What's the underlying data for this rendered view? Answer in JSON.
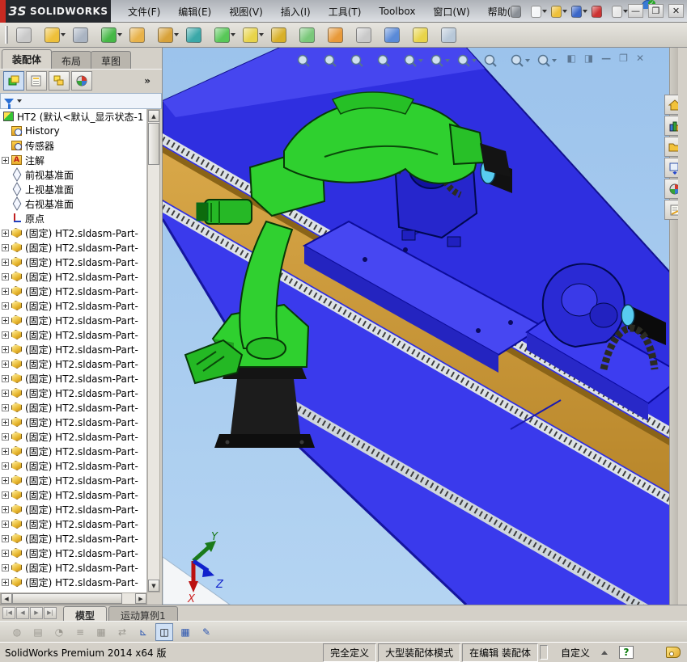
{
  "titlebar": {
    "logo_prefix": "ЗS",
    "logo_text": "SOLIDWORKS",
    "menus": [
      "文件(F)",
      "编辑(E)",
      "视图(V)",
      "插入(I)",
      "工具(T)",
      "Toolbox",
      "窗口(W)",
      "帮助(H)"
    ],
    "quick_icons": [
      {
        "name": "search-icon",
        "glyph": "🔎",
        "color": "#8a8f96",
        "caret": false
      },
      {
        "name": "new-document-icon",
        "glyph": "▯",
        "color": "#f4f6f8",
        "caret": true
      },
      {
        "name": "open-icon",
        "glyph": "▰",
        "color": "#eec03a",
        "caret": true
      },
      {
        "name": "save-icon",
        "glyph": "▦",
        "color": "#3a66c8",
        "caret": true
      },
      {
        "name": "performance-icon",
        "glyph": "▮",
        "color": "#cc3333",
        "caret": false
      },
      {
        "name": "help-icon",
        "glyph": "?",
        "color": "#e8e8e8",
        "caret": true
      }
    ],
    "window_buttons": [
      {
        "name": "minimize-button",
        "glyph": "—"
      },
      {
        "name": "restore-button",
        "glyph": "❐"
      },
      {
        "name": "close-button",
        "glyph": "✕"
      }
    ]
  },
  "main_toolbar": [
    {
      "name": "insert-component-button",
      "color": "#c9c9c9",
      "caret": false
    },
    {
      "name": "open-part-button",
      "color": "#eec03a",
      "caret": true
    },
    {
      "name": "mate-button",
      "color": "#aab4c2",
      "caret": false
    },
    {
      "name": "component-pattern-button",
      "color": "#46b846",
      "caret": true
    },
    {
      "name": "smart-fasteners-button",
      "color": "#e8b24a",
      "caret": false
    },
    {
      "name": "move-component-button",
      "color": "#d8a23a",
      "caret": true
    },
    {
      "name": "show-hidden-components-button",
      "color": "#3aa8a8",
      "caret": false
    },
    {
      "name": "assembly-features-button",
      "color": "#58c858",
      "caret": true
    },
    {
      "name": "reference-geometry-button",
      "color": "#e8d44a",
      "caret": true
    },
    {
      "name": "new-motion-study-button",
      "color": "#d8b028",
      "caret": false
    },
    {
      "name": "bill-of-materials-button",
      "color": "#7ac87a",
      "caret": false
    },
    {
      "name": "exploded-view-button",
      "color": "#e89a3a",
      "caret": false
    },
    {
      "name": "explode-line-sketch-button",
      "color": "#c9c9c9",
      "caret": false
    },
    {
      "name": "interference-detection-button",
      "color": "#5a8ad8",
      "caret": false
    },
    {
      "name": "assembly-xpert-button",
      "color": "#e8d44a",
      "caret": false
    },
    {
      "name": "take-snapshot-button",
      "color": "#b8c8d8",
      "caret": false
    }
  ],
  "left_panel": {
    "tabs": [
      {
        "label": "装配体",
        "active": true
      },
      {
        "label": "布局",
        "active": false
      },
      {
        "label": "草图",
        "active": false
      }
    ],
    "chevron": "»",
    "panel_buttons": [
      "featuremanager-tree-icon",
      "propertymanager-icon",
      "configurationmanager-icon",
      "appearances-manager-icon"
    ]
  },
  "tree": {
    "root": "HT2 (默认<默认_显示状态-1",
    "items": [
      {
        "icon": "history",
        "label": "History",
        "expand": false
      },
      {
        "icon": "sensors",
        "label": "传感器",
        "expand": false
      },
      {
        "icon": "annotations",
        "label": "注解",
        "expand": true
      },
      {
        "icon": "plane",
        "label": "前视基准面",
        "expand": false
      },
      {
        "icon": "plane",
        "label": "上视基准面",
        "expand": false
      },
      {
        "icon": "plane",
        "label": "右视基准面",
        "expand": false
      },
      {
        "icon": "origin",
        "label": "原点",
        "expand": false
      }
    ],
    "fixed_items": [
      "(固定) HT2.sldasm-Part-",
      "(固定) HT2.sldasm-Part-",
      "(固定) HT2.sldasm-Part-",
      "(固定) HT2.sldasm-Part-",
      "(固定) HT2.sldasm-Part-",
      "(固定) HT2.sldasm-Part-",
      "(固定) HT2.sldasm-Part-",
      "(固定) HT2.sldasm-Part-",
      "(固定) HT2.sldasm-Part-",
      "(固定) HT2.sldasm-Part-",
      "(固定) HT2.sldasm-Part-",
      "(固定) HT2.sldasm-Part-",
      "(固定) HT2.sldasm-Part-",
      "(固定) HT2.sldasm-Part-",
      "(固定) HT2.sldasm-Part-",
      "(固定) HT2.sldasm-Part-",
      "(固定) HT2.sldasm-Part-",
      "(固定) HT2.sldasm-Part-",
      "(固定) HT2.sldasm-Part-",
      "(固定) HT2.sldasm-Part-",
      "(固定) HT2.sldasm-Part-",
      "(固定) HT2.sldasm-Part-",
      "(固定) HT2.sldasm-Part-",
      "(固定) HT2.sldasm-Part-",
      "(固定) HT2.sldasm-Part-"
    ]
  },
  "viewport": {
    "headsup_icons": [
      {
        "name": "zoom-to-fit-icon",
        "caret": false
      },
      {
        "name": "zoom-to-area-icon",
        "caret": false
      },
      {
        "name": "magnified-selection-icon",
        "caret": false
      },
      {
        "name": "section-view-icon",
        "caret": false
      },
      {
        "name": "view-orientation-icon",
        "caret": true
      },
      {
        "name": "display-style-icon",
        "caret": true
      },
      {
        "name": "hide-show-items-icon",
        "caret": true
      },
      {
        "name": "edit-appearance-icon",
        "caret": false
      },
      {
        "name": "apply-scene-icon",
        "caret": true
      },
      {
        "name": "view-settings-icon",
        "caret": true
      }
    ],
    "window_controls": [
      {
        "name": "dock-left-button",
        "glyph": "◧"
      },
      {
        "name": "dock-right-button",
        "glyph": "◨"
      },
      {
        "name": "minimize-view-button",
        "glyph": "—"
      },
      {
        "name": "restore-view-button",
        "glyph": "❐"
      },
      {
        "name": "close-view-button",
        "glyph": "✕"
      }
    ],
    "triad": {
      "x": "X",
      "y": "Y",
      "z": "Z"
    }
  },
  "taskpane": {
    "buttons": [
      "solidworks-resources-icon",
      "design-library-icon",
      "file-explorer-icon",
      "view-palette-icon",
      "appearances-scenes-icon",
      "custom-properties-icon"
    ]
  },
  "bottom": {
    "nav_buttons": [
      "|◀",
      "◀",
      "▶",
      "▶|"
    ],
    "tabs": [
      {
        "label": "模型",
        "active": true
      },
      {
        "label": "运动算例1",
        "active": false
      }
    ],
    "motion_icons": [
      {
        "name": "filter-animation-icon",
        "glyph": "◍",
        "state": "disabled"
      },
      {
        "name": "calculate-icon",
        "glyph": "▤",
        "state": "disabled"
      },
      {
        "name": "play-from-start-icon",
        "glyph": "◔",
        "state": "disabled"
      },
      {
        "name": "results-icon",
        "glyph": "≡",
        "state": "disabled"
      },
      {
        "name": "mates-grid-icon",
        "glyph": "▦",
        "state": "disabled"
      },
      {
        "name": "key-properties-icon",
        "glyph": "⇄",
        "state": "disabled"
      },
      {
        "name": "chart-axes-icon",
        "glyph": "⊾",
        "state": "color"
      },
      {
        "name": "model-view-cube-icon",
        "glyph": "◫",
        "state": "sel"
      },
      {
        "name": "table-icon",
        "glyph": "▦",
        "state": "color"
      },
      {
        "name": "save-report-icon",
        "glyph": "✎",
        "state": "color"
      }
    ]
  },
  "statusbar": {
    "left_text": "SolidWorks Premium 2014 x64 版",
    "segments": [
      "完全定义",
      "大型装配体模式",
      "在编辑 装配体"
    ],
    "custom_label": "自定义",
    "help_glyph": "?"
  },
  "colors": {
    "accent_red": "#c92a21",
    "viewport_sky": "#a3c8ee",
    "deck_blue": "#2f2fe0",
    "robot_green": "#2fd02f",
    "rail_gold": "#c79032",
    "spindle_cyan": "#58ccf0"
  }
}
